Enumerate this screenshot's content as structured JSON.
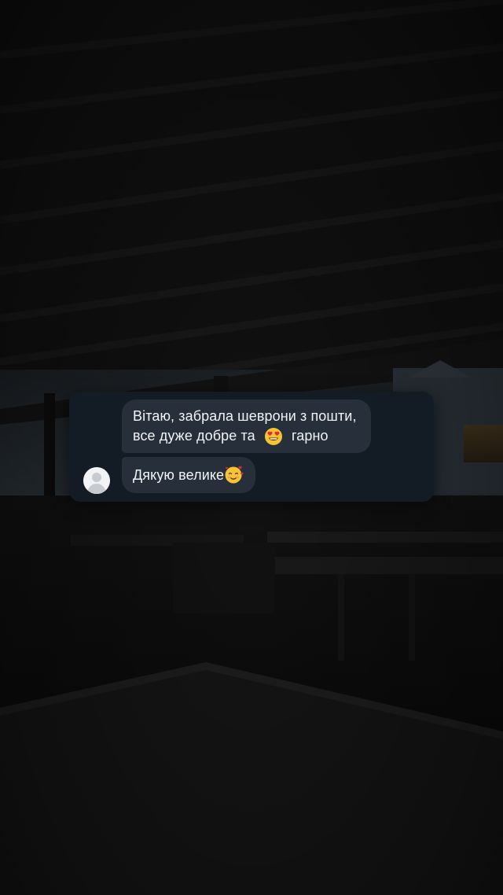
{
  "conversation": {
    "messages": [
      {
        "line1": "Вітаю, забрала шеврони з пошти,",
        "line2_before": "все дуже добре та",
        "line2_emoji": "smiling-face-with-heart-eyes-emoji",
        "line2_after": "гарно"
      },
      {
        "text": "Дякую велике",
        "emoji": "smiling-face-with-hearts-emoji"
      }
    ],
    "avatar": "default-profile-avatar"
  },
  "colors": {
    "card_background": "#131b24",
    "bubble_background": "#27303a",
    "text": "#f2f4f7"
  }
}
